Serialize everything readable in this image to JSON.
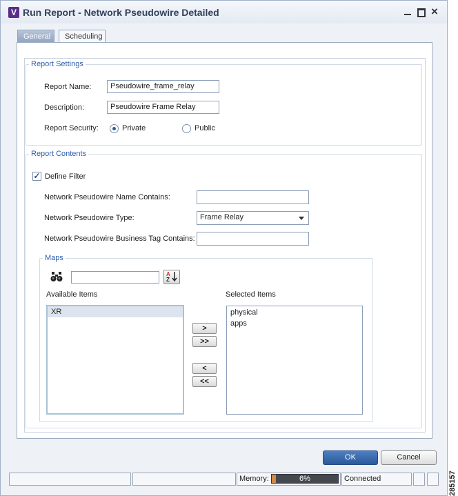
{
  "window": {
    "title": "Run Report - Network Pseudowire Detailed",
    "app_icon_letter": "V"
  },
  "tabs": [
    {
      "label": "General",
      "active": true
    },
    {
      "label": "Scheduling",
      "active": false
    }
  ],
  "report_settings": {
    "legend": "Report Settings",
    "name_label": "Report Name:",
    "name_value": "Pseudowire_frame_relay",
    "description_label": "Description:",
    "description_value": "Pseudowire Frame Relay",
    "security_label": "Report Security:",
    "security_options": [
      "Private",
      "Public"
    ],
    "security_selected": "Private"
  },
  "report_contents": {
    "legend": "Report Contents",
    "define_filter_label": "Define Filter",
    "define_filter_checked": true,
    "name_contains_label": "Network Pseudowire Name Contains:",
    "name_contains_value": "",
    "type_label": "Network Pseudowire Type:",
    "type_value": "Frame Relay",
    "business_tag_label": "Network Pseudowire Business Tag Contains:",
    "business_tag_value": ""
  },
  "maps": {
    "legend": "Maps",
    "search_value": "",
    "available_label": "Available Items",
    "available_items": [
      "XR"
    ],
    "selected_label": "Selected Items",
    "selected_items": [
      "physical",
      "apps"
    ],
    "move_buttons": [
      ">",
      ">>",
      "<",
      "<<"
    ]
  },
  "buttons": {
    "ok": "OK",
    "cancel": "Cancel"
  },
  "status_bar": {
    "memory_label": "Memory:",
    "memory_percent_text": "6%",
    "memory_fraction": 0.06,
    "connection_status": "Connected"
  },
  "figure_id": "285157",
  "colors": {
    "accent": "#2d5cae",
    "ok_button": "#2c5a9b",
    "memory_fill": "#d28a45"
  }
}
